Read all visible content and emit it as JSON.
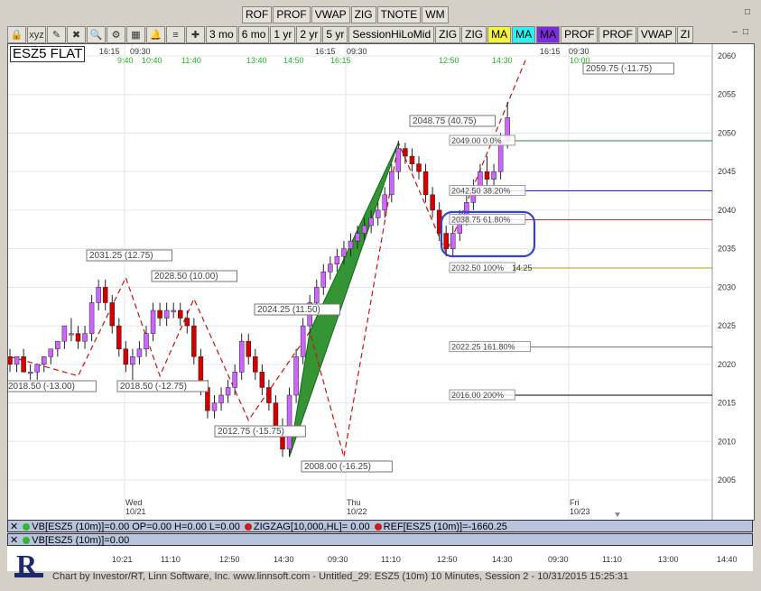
{
  "toolbar_top": {
    "buttons": [
      "ROF",
      "PROF",
      "VWAP",
      "ZIG",
      "TNOTE",
      "WM"
    ]
  },
  "toolbar_main": {
    "icons": [
      "lock-icon",
      "xyz-icon",
      "drawing-icon",
      "delete-icon",
      "zoom-icon",
      "settings-icon",
      "chart-icon",
      "bell-icon",
      "ticks-icon",
      "crosshair-icon"
    ],
    "ranges": [
      "3 mo",
      "6 mo",
      "1 yr",
      "2 yr",
      "5 yr"
    ],
    "studies": [
      {
        "label": "SessionHiLoMid",
        "style": ""
      },
      {
        "label": "ZIG",
        "style": ""
      },
      {
        "label": "ZIG",
        "style": ""
      },
      {
        "label": "MA",
        "style": "yellow"
      },
      {
        "label": "MA",
        "style": "cyan"
      },
      {
        "label": "MA",
        "style": "purple"
      },
      {
        "label": "PROF",
        "style": ""
      },
      {
        "label": "PROF",
        "style": ""
      },
      {
        "label": "VWAP",
        "style": ""
      },
      {
        "label": "ZI",
        "style": ""
      }
    ]
  },
  "symbol": "ESZ5 FLAT",
  "chart_data": {
    "type": "candlestick",
    "y_axis": {
      "min": 2005,
      "max": 2060,
      "ticks": [
        2005,
        2010,
        2015,
        2020,
        2025,
        2030,
        2035,
        2040,
        2045,
        2050,
        2055,
        2060
      ]
    },
    "x_axis_labels": [
      {
        "label": "10:21",
        "x": 134
      },
      {
        "label": "11:10",
        "x": 188
      },
      {
        "label": "12:50",
        "x": 253
      },
      {
        "label": "14:30",
        "x": 313
      },
      {
        "label": "09:30",
        "x": 373
      },
      {
        "label": "11:10",
        "x": 432
      },
      {
        "label": "12:50",
        "x": 494
      },
      {
        "label": "14:30",
        "x": 555
      },
      {
        "label": "09:30",
        "x": 617
      },
      {
        "label": "11:10",
        "x": 677
      },
      {
        "label": "13:00",
        "x": 739
      },
      {
        "label": "14:40",
        "x": 804
      }
    ],
    "top_time_labels": [
      {
        "label": "16:15",
        "x": 109,
        "c": "#333"
      },
      {
        "label": "09:30",
        "x": 143,
        "c": "#333"
      },
      {
        "label": "9:40",
        "x": 129,
        "c": "#1eb81e"
      },
      {
        "label": "10:40",
        "x": 156,
        "c": "#1eb81e"
      },
      {
        "label": "11:40",
        "x": 200,
        "c": "#1eb81e"
      },
      {
        "label": "13:40",
        "x": 272,
        "c": "#1eb81e"
      },
      {
        "label": "14:50",
        "x": 313,
        "c": "#1eb81e"
      },
      {
        "label": "16:15",
        "x": 348,
        "c": "#333"
      },
      {
        "label": "09:30",
        "x": 383,
        "c": "#333"
      },
      {
        "label": "16:15",
        "x": 365,
        "c": "#1eb81e"
      },
      {
        "label": "12:50",
        "x": 485,
        "c": "#1eb81e"
      },
      {
        "label": "14:30",
        "x": 544,
        "c": "#1eb81e"
      },
      {
        "label": "16:15",
        "x": 597,
        "c": "#333"
      },
      {
        "label": "09:30",
        "x": 629,
        "c": "#333"
      },
      {
        "label": "10:00",
        "x": 630,
        "c": "#1eb81e"
      }
    ],
    "day_labels": [
      {
        "day": "Wed",
        "date": "10/21",
        "x": 137
      },
      {
        "day": "Thu",
        "date": "10/22",
        "x": 382
      },
      {
        "day": "Fri",
        "date": "10/23",
        "x": 629
      }
    ],
    "pivot_labels": [
      {
        "text": "2031.25 (12.75)",
        "x": 95,
        "y": 285
      },
      {
        "text": "2028.50 (10.00)",
        "x": 167,
        "y": 308
      },
      {
        "text": "2024.25 (11.50)",
        "x": 281,
        "y": 345
      },
      {
        "text": "2048.75 (40.75)",
        "x": 453,
        "y": 136
      },
      {
        "text": "2059.75 (-11.75)",
        "x": 645,
        "y": 78
      },
      {
        "text": "2018.50 (-13.00)",
        "x": 5,
        "y": 430
      },
      {
        "text": "2018.50 (-12.75)",
        "x": 129,
        "y": 430
      },
      {
        "text": "2012.75 (-15.75)",
        "x": 237,
        "y": 480
      },
      {
        "text": "2008.00 (-16.25)",
        "x": 333,
        "y": 519
      }
    ],
    "fib_levels": [
      {
        "text": "2049.00 0.0%",
        "price": 2049.0,
        "color": "#2a8a2a"
      },
      {
        "text": "2042.50 38.20%",
        "price": 2042.5,
        "color": "#1c1cc8"
      },
      {
        "text": "2038.75 61.80%",
        "price": 2038.75,
        "color": "#d01c1c"
      },
      {
        "text": "2032.50 100%",
        "price": 2032.5,
        "color": "#a8a800"
      },
      {
        "text": "2022.25 161.80%",
        "price": 2022.25,
        "color": "#707070"
      },
      {
        "text": "2016.00 200%",
        "price": 2016.0,
        "color": "#000000"
      }
    ],
    "fib_extra": "14.25",
    "series": [
      {
        "name": "ESZ5",
        "candles": [
          [
            2021,
            2022,
            2019,
            2020
          ],
          [
            2020,
            2021,
            2019,
            2021
          ],
          [
            2021,
            2022,
            2019,
            2019
          ],
          [
            2019,
            2020,
            2018,
            2019
          ],
          [
            2019,
            2020,
            2018,
            2020
          ],
          [
            2020,
            2021,
            2019,
            2021
          ],
          [
            2021,
            2022,
            2020,
            2022
          ],
          [
            2022,
            2023,
            2021,
            2023
          ],
          [
            2023,
            2025,
            2022,
            2025
          ],
          [
            2024,
            2026,
            2023,
            2024
          ],
          [
            2024,
            2025,
            2022,
            2023
          ],
          [
            2023,
            2025,
            2022,
            2024
          ],
          [
            2024,
            2029,
            2023,
            2028
          ],
          [
            2028,
            2031,
            2027,
            2030
          ],
          [
            2030,
            2031,
            2027,
            2028
          ],
          [
            2028,
            2029,
            2024,
            2025
          ],
          [
            2025,
            2026,
            2021,
            2022
          ],
          [
            2022,
            2023,
            2019,
            2020
          ],
          [
            2020,
            2022,
            2018,
            2021
          ],
          [
            2021,
            2023,
            2020,
            2022
          ],
          [
            2022,
            2025,
            2021,
            2024
          ],
          [
            2024,
            2028,
            2023,
            2027
          ],
          [
            2027,
            2028,
            2025,
            2026
          ],
          [
            2026,
            2028,
            2025,
            2027
          ],
          [
            2027,
            2028,
            2026,
            2027
          ],
          [
            2027,
            2028,
            2025,
            2026
          ],
          [
            2026,
            2027,
            2024,
            2025
          ],
          [
            2025,
            2026,
            2020,
            2021
          ],
          [
            2021,
            2022,
            2016,
            2017
          ],
          [
            2017,
            2018,
            2013,
            2014
          ],
          [
            2014,
            2016,
            2013,
            2015
          ],
          [
            2015,
            2017,
            2014,
            2016
          ],
          [
            2016,
            2018,
            2015,
            2017
          ],
          [
            2017,
            2020,
            2016,
            2019
          ],
          [
            2019,
            2024,
            2018,
            2023
          ],
          [
            2023,
            2024,
            2020,
            2021
          ],
          [
            2021,
            2022,
            2018,
            2019
          ],
          [
            2019,
            2020,
            2016,
            2017
          ],
          [
            2017,
            2018,
            2014,
            2015
          ],
          [
            2015,
            2016,
            2011,
            2012
          ],
          [
            2012,
            2013,
            2008,
            2009
          ],
          [
            2009,
            2017,
            2008,
            2016
          ],
          [
            2016,
            2022,
            2015,
            2021
          ],
          [
            2021,
            2026,
            2020,
            2025
          ],
          [
            2025,
            2029,
            2024,
            2028
          ],
          [
            2028,
            2031,
            2027,
            2030
          ],
          [
            2030,
            2033,
            2029,
            2032
          ],
          [
            2032,
            2034,
            2031,
            2033
          ],
          [
            2033,
            2035,
            2032,
            2034
          ],
          [
            2034,
            2036,
            2033,
            2035
          ],
          [
            2035,
            2037,
            2034,
            2036
          ],
          [
            2036,
            2038,
            2035,
            2037
          ],
          [
            2037,
            2039,
            2036,
            2038
          ],
          [
            2038,
            2040,
            2037,
            2039
          ],
          [
            2039,
            2041,
            2038,
            2040
          ],
          [
            2040,
            2043,
            2039,
            2042
          ],
          [
            2042,
            2046,
            2041,
            2045
          ],
          [
            2045,
            2049,
            2044,
            2048
          ],
          [
            2048,
            2048.75,
            2046,
            2047
          ],
          [
            2047,
            2048,
            2045,
            2046
          ],
          [
            2046,
            2047,
            2044,
            2045
          ],
          [
            2045,
            2046,
            2041,
            2042
          ],
          [
            2042,
            2043,
            2039,
            2040
          ],
          [
            2040,
            2041,
            2036,
            2037
          ],
          [
            2037,
            2038,
            2034,
            2035
          ],
          [
            2035,
            2038,
            2034,
            2037
          ],
          [
            2037,
            2040,
            2036,
            2039
          ],
          [
            2039,
            2042,
            2038,
            2041
          ],
          [
            2041,
            2044,
            2040,
            2043
          ],
          [
            2043,
            2046,
            2042,
            2045
          ],
          [
            2045,
            2047,
            2043,
            2044
          ],
          [
            2044,
            2046,
            2042,
            2045
          ],
          [
            2045,
            2050,
            2044,
            2049
          ],
          [
            2049,
            2054,
            2048,
            2052
          ]
        ]
      }
    ]
  },
  "indicators": {
    "row1": {
      "vb": "VB[ESZ5 (10m)]=0.00 OP=0.00 H=0.00 L=0.00",
      "zigzag": "ZIGZAG[10,000,HL]= 0.00",
      "ref": "REF[ESZ5 (10m)]=-1660.25"
    },
    "row2": {
      "vb": "VB[ESZ5 (10m)]=0.00"
    }
  },
  "colors": {
    "up": "#cc66ff",
    "down": "#d40000",
    "green_fill": "#1f8a1f",
    "accent_blue": "#3344cc"
  },
  "footer": "Chart by Investor/RT, Linn Software, Inc.  www.linnsoft.com - Untitled_29: ESZ5 (10m) 10 Minutes, Session 2 - 10/31/2015 15:25:31",
  "logo_text": "R"
}
